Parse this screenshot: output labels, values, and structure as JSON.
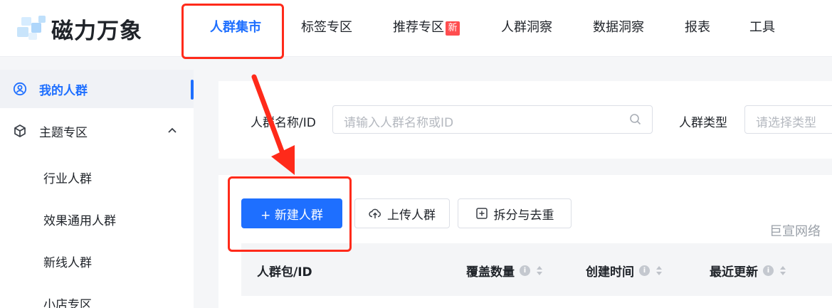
{
  "brand": {
    "name": "磁力万象"
  },
  "nav": {
    "items": [
      {
        "label": "人群集市"
      },
      {
        "label": "标签专区"
      },
      {
        "label": "推荐专区",
        "badge": "新"
      },
      {
        "label": "人群洞察"
      },
      {
        "label": "数据洞察"
      },
      {
        "label": "报表"
      },
      {
        "label": "工具"
      }
    ]
  },
  "sidebar": {
    "items": [
      {
        "label": "我的人群",
        "icon": "user-circle-icon"
      },
      {
        "label": "主题专区",
        "icon": "cube-icon"
      }
    ],
    "sub_items": [
      "行业人群",
      "效果通用人群",
      "新线人群",
      "小店专区"
    ]
  },
  "filters": {
    "name_label": "人群名称/ID",
    "name_placeholder": "请输入人群名称或ID",
    "type_label": "人群类型",
    "type_placeholder": "请选择类型"
  },
  "actions": {
    "create": "+ 新建人群",
    "upload": "上传人群",
    "split": "拆分与去重"
  },
  "table": {
    "columns": [
      "人群包/ID",
      "覆盖数量",
      "创建时间",
      "最近更新"
    ]
  },
  "watermark": "巨宣网络",
  "colors": {
    "accent": "#1e6fff",
    "annotation": "#ff2a1a",
    "badge": "#ff4d4f"
  }
}
